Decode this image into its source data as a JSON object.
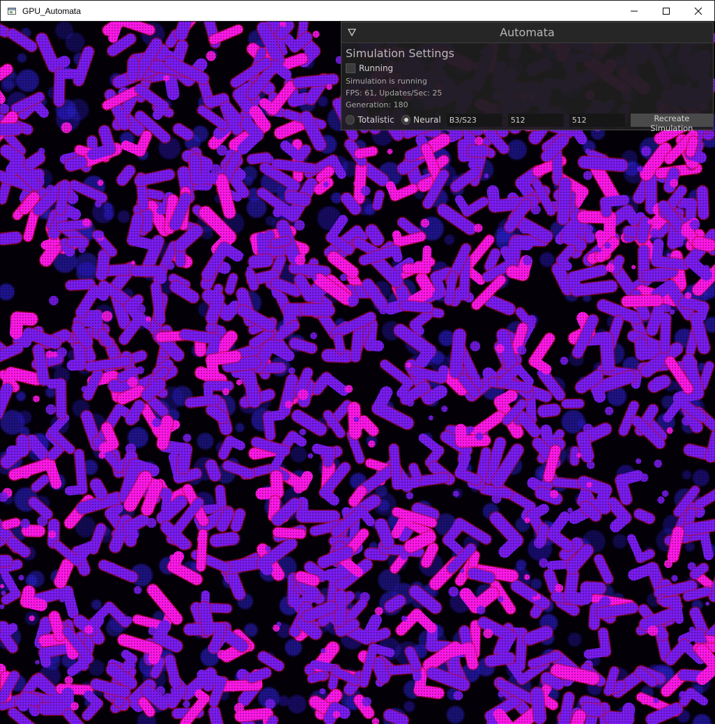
{
  "window": {
    "title": "GPU_Automata",
    "controls": [
      "minimize-icon",
      "maximize-icon",
      "close-icon"
    ]
  },
  "panel": {
    "title": "Automata",
    "collapse_icon": "collapse-triangle-icon",
    "section_title": "Simulation Settings",
    "running_label": "Running",
    "running_checked": false,
    "status_text": "Simulation is running",
    "fps_text": "FPS: 61, Updates/Sec: 25",
    "generation_text": "Generation: 180",
    "mode_options": [
      "Totalistic",
      "Neural"
    ],
    "selected_mode": "Neural",
    "rule_value": "B3/S23",
    "width_value": "512",
    "height_value": "512",
    "recreate_label": "Recreate Simulation"
  },
  "colors": {
    "background": "#040008",
    "cell_violet": "#7a1cf0",
    "cell_magenta": "#ff18e8",
    "cell_blue": "#2a1cc8",
    "cell_edge_red": "#d0082a"
  }
}
